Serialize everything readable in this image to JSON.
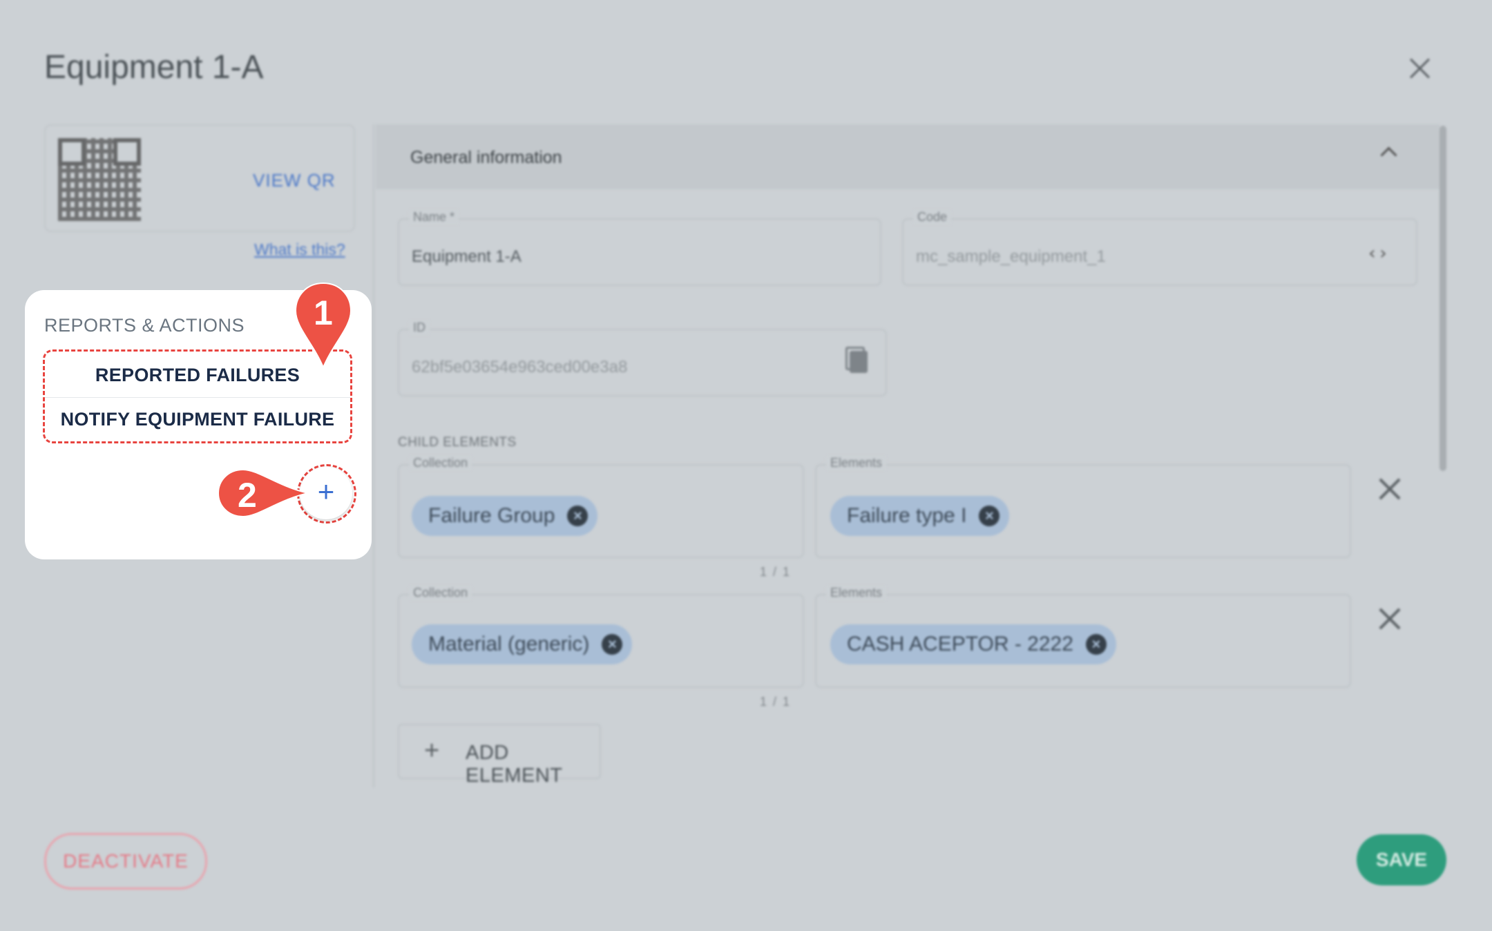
{
  "dialog": {
    "title": "Equipment 1-A",
    "qr": {
      "view_label": "VIEW QR",
      "help_link": "What is this?"
    },
    "general": {
      "header": "General information",
      "name": {
        "label": "Name *",
        "value": "Equipment 1-A"
      },
      "code": {
        "label": "Code",
        "value": "mc_sample_equipment_1"
      },
      "id": {
        "label": "ID",
        "value": "62bf5e03654e963ced00e3a8"
      }
    },
    "child_elements": {
      "label": "CHILD ELEMENTS",
      "rows": [
        {
          "collection_label": "Collection",
          "collection": "Failure Group",
          "elements_label": "Elements",
          "element": "Failure type I",
          "pager": "1 / 1"
        },
        {
          "collection_label": "Collection",
          "collection": "Material (generic)",
          "elements_label": "Elements",
          "element": "CASH ACEPTOR - 2222",
          "pager": "1 / 1"
        }
      ],
      "add_label": "ADD ELEMENT"
    },
    "footer": {
      "deactivate": "DEACTIVATE",
      "save": "SAVE"
    }
  },
  "reports": {
    "heading": "REPORTS & ACTIONS",
    "items": [
      "REPORTED FAILURES",
      "NOTIFY EQUIPMENT FAILURE"
    ],
    "add_icon": "plus-icon"
  },
  "callouts": [
    "1",
    "2"
  ],
  "colors": {
    "accent": "#3b6fd1",
    "highlight": "#e8443f",
    "save": "#2e9d7d",
    "danger": "#e57986"
  }
}
